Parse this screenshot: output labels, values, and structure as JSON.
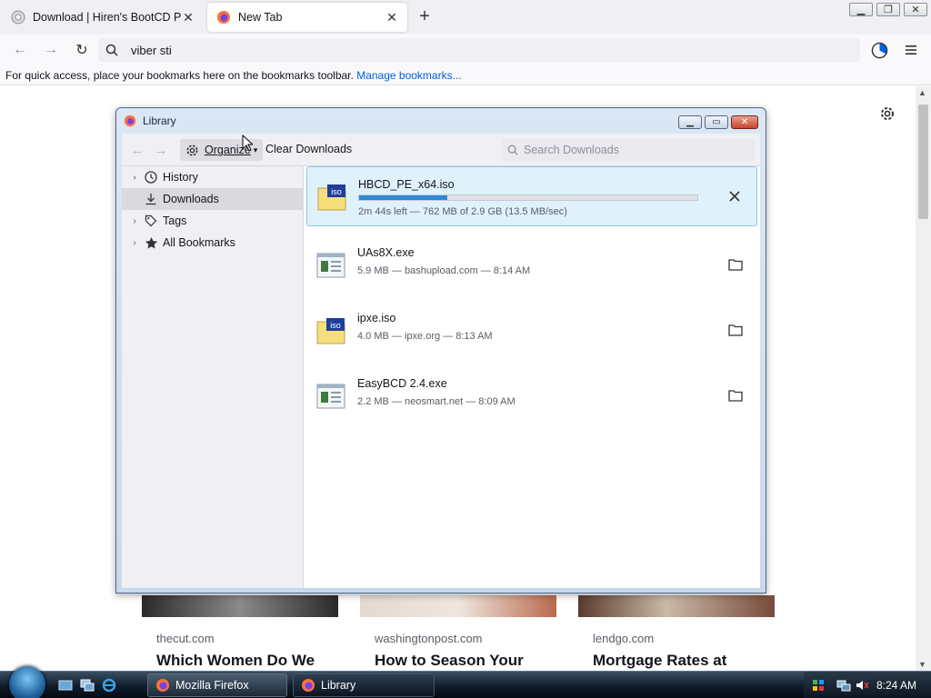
{
  "browser": {
    "tabs": [
      {
        "title": "Download | Hiren's BootCD PE",
        "active": false
      },
      {
        "title": "New Tab",
        "active": true
      }
    ],
    "url_value": "viber sti",
    "bookmarks_bar": {
      "message": "For quick access, place your bookmarks here on the bookmarks toolbar.",
      "link": "Manage bookmarks..."
    }
  },
  "page": {
    "cards": [
      {
        "source": "thecut.com",
        "headline": "Which Women Do We"
      },
      {
        "source": "washingtonpost.com",
        "headline": "How to Season Your"
      },
      {
        "source": "lendgo.com",
        "headline": "Mortgage Rates at"
      }
    ]
  },
  "library": {
    "title": "Library",
    "toolbar": {
      "organize": "Organize",
      "clear": "Clear Downloads",
      "search_placeholder": "Search Downloads"
    },
    "sidebar": [
      {
        "label": "History",
        "icon": "clock-icon",
        "expandable": true,
        "selected": false
      },
      {
        "label": "Downloads",
        "icon": "download-icon",
        "expandable": false,
        "selected": true
      },
      {
        "label": "Tags",
        "icon": "tag-icon",
        "expandable": true,
        "selected": false
      },
      {
        "label": "All Bookmarks",
        "icon": "star-icon",
        "expandable": true,
        "selected": false
      }
    ],
    "downloads": [
      {
        "name": "HBCD_PE_x64.iso",
        "status": "2m 44s left — 762 MB of 2.9 GB (13.5 MB/sec)",
        "progress": 0.26,
        "in_progress": true,
        "icon": "iso-file-icon",
        "action": "cancel-icon"
      },
      {
        "name": "UAs8X.exe",
        "status": "5.9 MB — bashupload.com — 8:14 AM",
        "in_progress": false,
        "icon": "exe-file-icon",
        "action": "folder-icon"
      },
      {
        "name": "ipxe.iso",
        "status": "4.0 MB — ipxe.org — 8:13 AM",
        "in_progress": false,
        "icon": "iso-file-icon",
        "action": "folder-icon"
      },
      {
        "name": "EasyBCD 2.4.exe",
        "status": "2.2 MB — neosmart.net — 8:09 AM",
        "in_progress": false,
        "icon": "exe-file-icon",
        "action": "folder-icon"
      }
    ]
  },
  "taskbar": {
    "buttons": [
      {
        "label": "Mozilla Firefox",
        "active": false
      },
      {
        "label": "Library",
        "active": true
      }
    ],
    "clock": "8:24 AM"
  }
}
